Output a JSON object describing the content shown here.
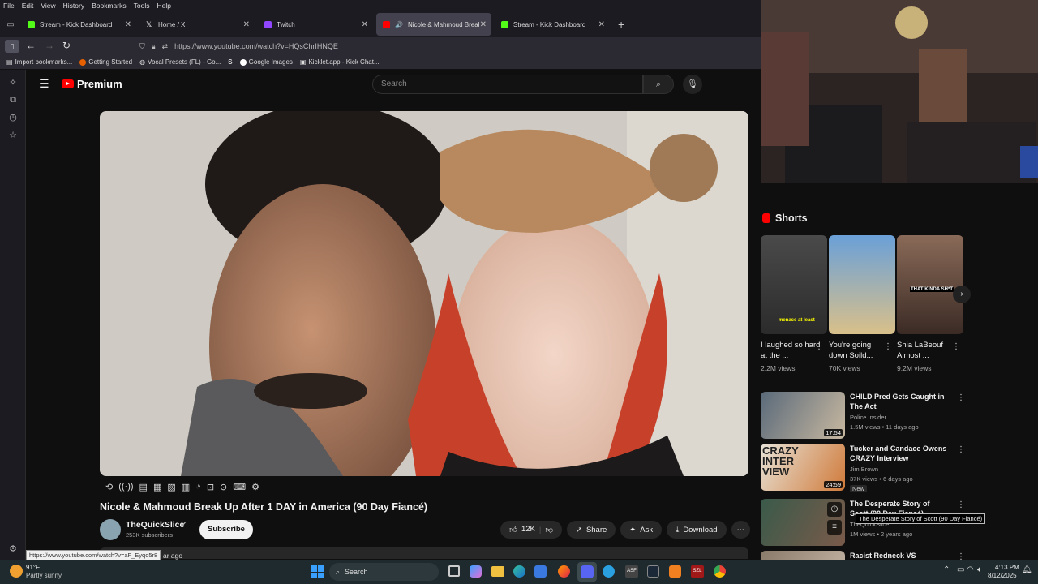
{
  "menubar": [
    "File",
    "Edit",
    "View",
    "History",
    "Bookmarks",
    "Tools",
    "Help"
  ],
  "tabs": [
    {
      "title": "Stream - Kick Dashboard",
      "color": "#53fc18",
      "active": false
    },
    {
      "title": "Home / X",
      "color": "#ffffff",
      "active": false
    },
    {
      "title": "Twitch",
      "color": "#9146ff",
      "active": false
    },
    {
      "title": "Nicole & Mahmoud Break",
      "color": "#ff0000",
      "active": true
    },
    {
      "title": "Stream - Kick Dashboard",
      "color": "#53fc18",
      "active": false
    }
  ],
  "url": "https://www.youtube.com/watch?v=HQsChrIHNQE",
  "bookmarks": [
    "Import bookmarks...",
    "Getting Started",
    "Vocal Presets (FL) - Go...",
    "S",
    "Google Images",
    "Kicklet.app - Kick Chat..."
  ],
  "youtube": {
    "logo": "Premium",
    "search_placeholder": "Search",
    "video_title": "Nicole & Mahmoud Break Up After 1 DAY in America (90 Day Fiancé)",
    "channel_name": "TheQuickSlice",
    "subscribers": "253K subscribers",
    "subscribe_label": "Subscribe",
    "likes": "12K",
    "share": "Share",
    "ask": "Ask",
    "download": "Download",
    "desc_snippet": "ar ago",
    "url_tooltip": "https://www.youtube.com/watch?v=aF_Eyqo5r8"
  },
  "shorts": {
    "header": "Shorts",
    "items": [
      {
        "title": "I laughed so hard at the ...",
        "views": "2.2M views",
        "colors": [
          "#4a4a4a",
          "#2b2b2b"
        ],
        "caption": "menace at least"
      },
      {
        "title": "You're going down Soild...",
        "views": "70K views",
        "colors": [
          "#6aa0d8",
          "#d9c08a"
        ],
        "caption": ""
      },
      {
        "title": "Shia LaBeouf Almost ...",
        "views": "9.2M views",
        "colors": [
          "#8a6a58",
          "#3b2b25"
        ],
        "caption": "THAT KINDA SH*T"
      }
    ]
  },
  "recommended": [
    {
      "title": "CHILD Pred Gets Caught in The Act",
      "channel": "Police Insider",
      "meta": "1.5M views • 11 days ago",
      "duration": "17:54",
      "badge": "",
      "colors": [
        "#5a6a7a",
        "#c8b8a0"
      ]
    },
    {
      "title": "Tucker and Candace Owens CRAZY Interview",
      "channel": "Jim Brown",
      "meta": "37K views • 6 days ago",
      "duration": "24:59",
      "badge": "New",
      "colors": [
        "#e7e2d6",
        "#d07a3a"
      ]
    },
    {
      "title": "The Desperate Story of Scott (90 Day Fiancé)",
      "channel": "TheQuickSlice",
      "meta": "1M views • 2 years ago",
      "duration": "",
      "badge": "",
      "colors": [
        "#3a5a4a",
        "#7a5a4a"
      ]
    },
    {
      "title": "Racist Redneck VS",
      "channel": "",
      "meta": "",
      "duration": "",
      "badge": "",
      "colors": [
        "#8a7a6a",
        "#c8b8a8"
      ]
    }
  ],
  "tooltip": "The Desperate Story of Scott (90 Day Fiancé)",
  "taskbar": {
    "weather_temp": "91°F",
    "weather_desc": "Partly sunny",
    "search": "Search",
    "time": "4:13 PM",
    "date": "8/12/2025"
  }
}
